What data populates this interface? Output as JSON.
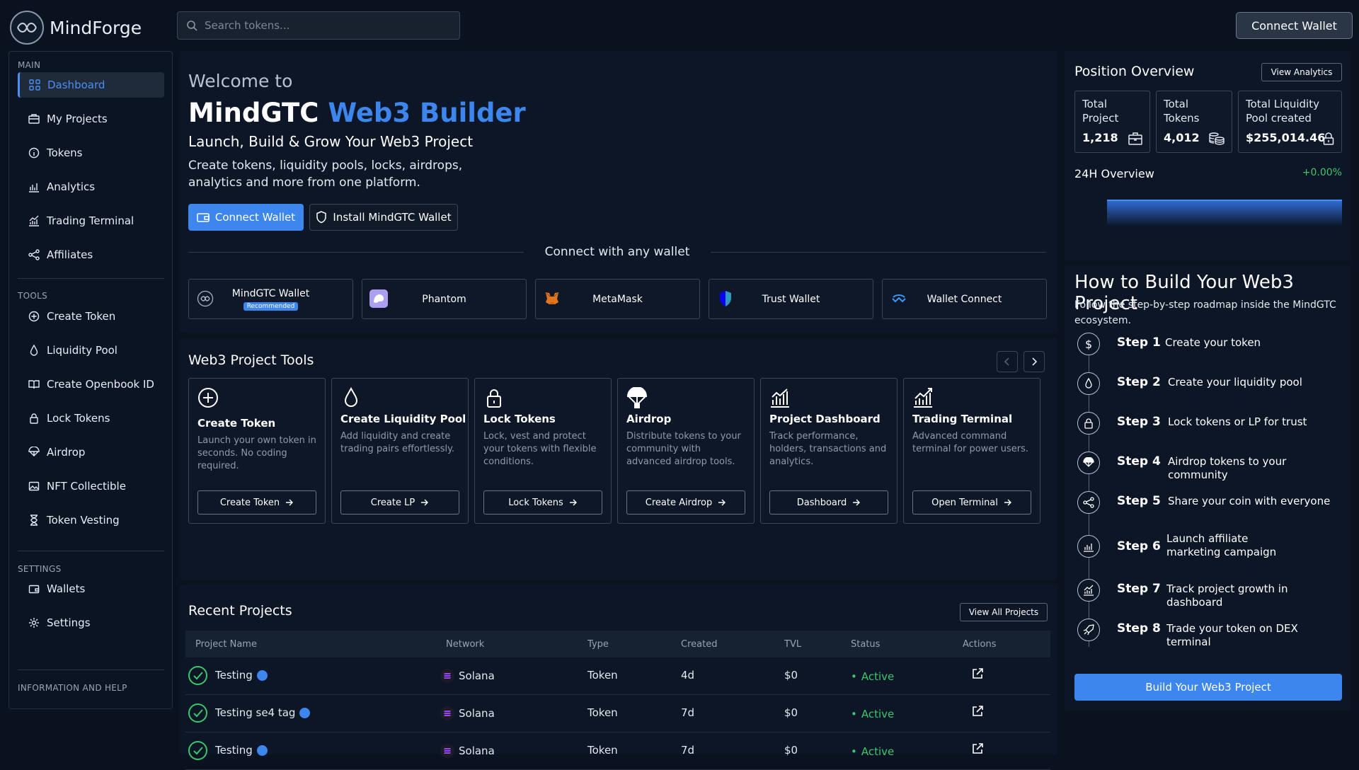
{
  "app": {
    "name": "MindForge"
  },
  "search": {
    "placeholder": "Search tokens..."
  },
  "header": {
    "connect_label": "Connect Wallet"
  },
  "sidebar": {
    "main_title": "MAIN",
    "tools_title": "TOOLS",
    "settings_title": "SETTINGS",
    "info_title": "INFORMATION AND HELP",
    "main_items": [
      {
        "label": "Dashboard",
        "icon": "grid-icon"
      },
      {
        "label": "My Projects",
        "icon": "briefcase-icon"
      },
      {
        "label": "Tokens",
        "icon": "info-circle-icon"
      },
      {
        "label": "Analytics",
        "icon": "bar-chart-icon"
      },
      {
        "label": "Trading Terminal",
        "icon": "trend-chart-icon"
      },
      {
        "label": "Affiliates",
        "icon": "share-icon"
      }
    ],
    "tool_items": [
      {
        "label": "Create Token",
        "icon": "plus-circle-icon"
      },
      {
        "label": "Liquidity Pool",
        "icon": "droplet-icon"
      },
      {
        "label": "Create Openbook ID",
        "icon": "book-icon"
      },
      {
        "label": "Lock Tokens",
        "icon": "lock-icon"
      },
      {
        "label": "Airdrop",
        "icon": "parachute-icon"
      },
      {
        "label": "NFT Collectible",
        "icon": "image-icon"
      },
      {
        "label": "Token Vesting",
        "icon": "hourglass-icon"
      }
    ],
    "settings_items": [
      {
        "label": "Wallets",
        "icon": "wallet-icon"
      },
      {
        "label": "Settings",
        "icon": "gear-icon"
      }
    ]
  },
  "hero": {
    "welcome": "Welcome to",
    "title_a": "MindGTC",
    "title_b": "Web3 Builder",
    "subtitle": "Launch, Build & Grow Your Web3 Project",
    "description": "Create tokens, liquidity pools, locks, airdrops, analytics and more from one platform.",
    "connect_label": "Connect Wallet",
    "install_label": "Install MindGTC Wallet",
    "connect_any": "Connect with any wallet"
  },
  "wallets": [
    {
      "name": "MindGTC Wallet",
      "badge": "Recommended",
      "icon": "mindgtc-logo-icon"
    },
    {
      "name": "Phantom",
      "icon": "phantom-icon"
    },
    {
      "name": "MetaMask",
      "icon": "metamask-fox-icon"
    },
    {
      "name": "Trust Wallet",
      "icon": "trust-shield-icon"
    },
    {
      "name": "Wallet Connect",
      "icon": "walletconnect-icon"
    }
  ],
  "tools": {
    "title": "Web3 Project Tools",
    "cards": [
      {
        "name": "Create Token",
        "desc": "Launch your own token in seconds. No coding required.",
        "button": "Create Token",
        "icon": "plus-circle-icon"
      },
      {
        "name": "Create Liquidity Pool",
        "desc": "Add liquidity and create trading pairs effortlessly.",
        "button": "Create LP",
        "icon": "droplet-icon"
      },
      {
        "name": "Lock Tokens",
        "desc": "Lock, vest and protect your tokens with flexible conditions.",
        "button": "Lock Tokens",
        "icon": "lock-icon"
      },
      {
        "name": "Airdrop",
        "desc": "Distribute tokens to your community with advanced airdrop tools.",
        "button": "Create Airdrop",
        "icon": "parachute-icon"
      },
      {
        "name": "Project Dashboard",
        "desc": "Track performance, holders, transactions and analytics.",
        "button": "Dashboard",
        "icon": "bar-chart-icon"
      },
      {
        "name": "Trading Terminal",
        "desc": "Advanced command terminal for power users.",
        "button": "Open Terminal",
        "icon": "trend-chart-icon"
      }
    ]
  },
  "recent": {
    "title": "Recent Projects",
    "view_all": "View All Projects",
    "columns": [
      "Project Name",
      "Network",
      "Type",
      "Created",
      "TVL",
      "Status",
      "Actions"
    ],
    "rows": [
      {
        "name": "Testing",
        "network": "Solana",
        "type": "Token",
        "created": "4d",
        "tvl": "$0",
        "status": "Active"
      },
      {
        "name": "Testing se4 tag",
        "network": "Solana",
        "type": "Token",
        "created": "7d",
        "tvl": "$0",
        "status": "Active"
      },
      {
        "name": "Testing",
        "network": "Solana",
        "type": "Token",
        "created": "7d",
        "tvl": "$0",
        "status": "Active"
      }
    ]
  },
  "position": {
    "title": "Position Overview",
    "view_analytics": "View Analytics",
    "stats": [
      {
        "label": "Total Project",
        "value": "1,218",
        "icon": "briefcase-icon"
      },
      {
        "label": "Total Tokens",
        "value": "4,012",
        "icon": "coins-icon"
      },
      {
        "label": "Total Liquidity Pool created",
        "value": "$255,014.46",
        "icon": "lock-icon"
      }
    ],
    "overview_title": "24H Overview",
    "overview_change": "+0.00%"
  },
  "how": {
    "title": "How to Build Your Web3 Project",
    "desc": "Follow the step-by-step roadmap inside the MindGTC ecosystem.",
    "steps": [
      {
        "n": "Step 1",
        "text": "Create your token",
        "icon": "dollar-icon"
      },
      {
        "n": "Step 2",
        "text": "Create your liquidity pool",
        "icon": "droplet-icon"
      },
      {
        "n": "Step 3",
        "text": "Lock tokens or LP for trust",
        "icon": "lock-icon"
      },
      {
        "n": "Step 4",
        "text": "Airdrop tokens to your community",
        "icon": "parachute-icon"
      },
      {
        "n": "Step 5",
        "text": "Share your coin with everyone",
        "icon": "share-icon"
      },
      {
        "n": "Step 6",
        "text": "Launch affiliate marketing campaign",
        "icon": "bar-chart-icon"
      },
      {
        "n": "Step 7",
        "text": "Track project growth in dashboard",
        "icon": "trend-chart-icon"
      },
      {
        "n": "Step 8",
        "text": "Trade your token on DEX terminal",
        "icon": "rocket-icon"
      }
    ],
    "build_label": "Build Your Web3 Project"
  },
  "colors": {
    "accent": "#3d86ee",
    "success": "#3cc66a",
    "background": "#0a1220"
  }
}
